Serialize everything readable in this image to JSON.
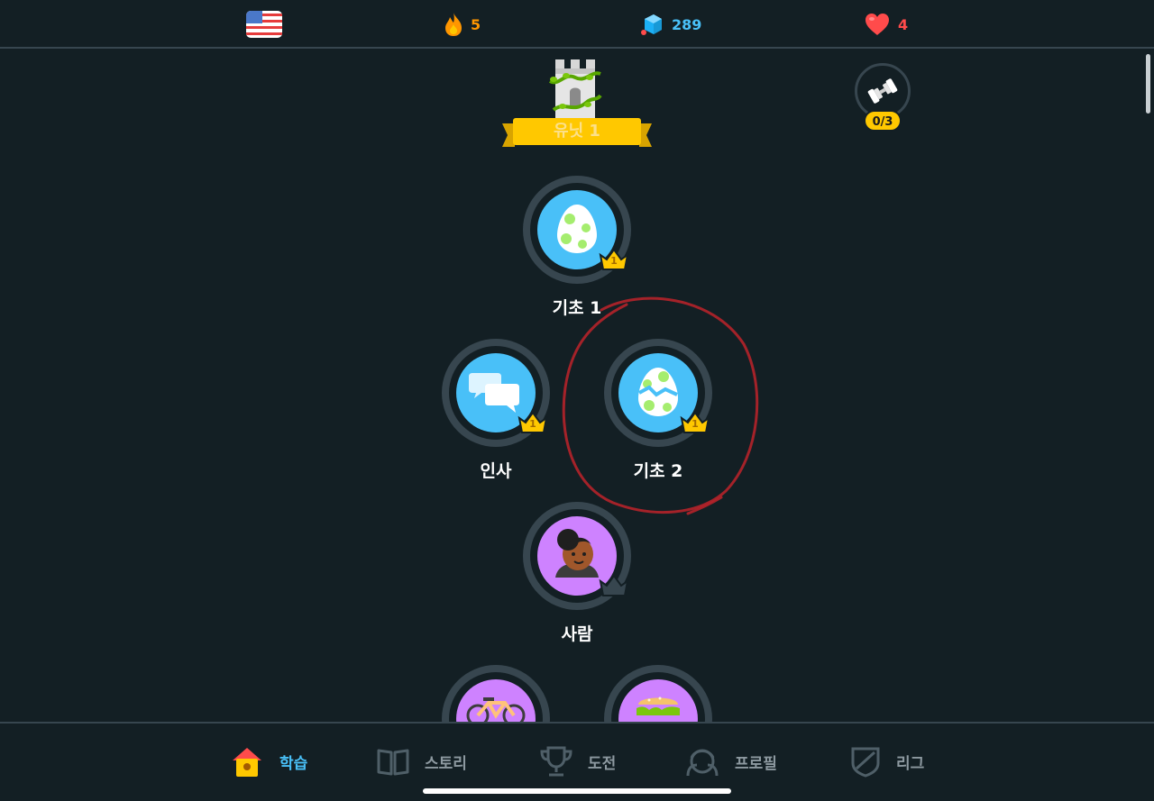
{
  "topbar": {
    "language": "english-us-flag",
    "streak": "5",
    "gems": "289",
    "hearts": "4"
  },
  "unit": {
    "label": "유닛 1"
  },
  "practice": {
    "count": "0/3"
  },
  "skills": [
    {
      "id": "basics1",
      "label": "기초 1",
      "crown_level": "1"
    },
    {
      "id": "greetings",
      "label": "인사",
      "crown_level": "1"
    },
    {
      "id": "basics2",
      "label": "기초 2",
      "crown_level": "1"
    },
    {
      "id": "people",
      "label": "사람",
      "crown_level": ""
    },
    {
      "id": "travel",
      "label": "",
      "crown_level": ""
    },
    {
      "id": "food",
      "label": "",
      "crown_level": ""
    }
  ],
  "nav": {
    "learn": "학습",
    "stories": "스토리",
    "challenge": "도전",
    "profile": "프로필",
    "league": "리그"
  },
  "colors": {
    "background": "#131f24",
    "accent_blue": "#49c0f8",
    "gold": "#ffc800",
    "purple": "#ce82ff",
    "annotation_red": "#b5222a"
  }
}
